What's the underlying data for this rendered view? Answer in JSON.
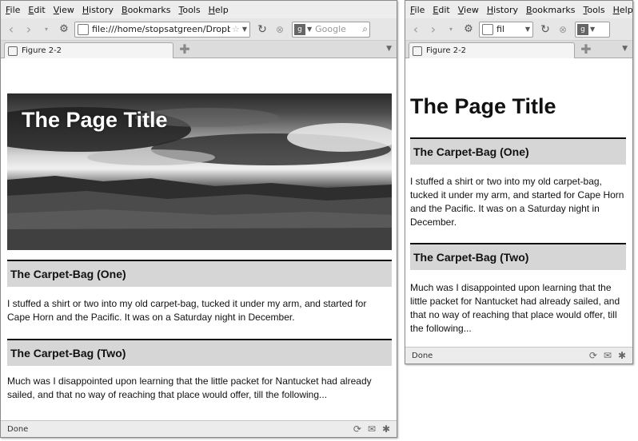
{
  "browser": {
    "menu": [
      "File",
      "Edit",
      "View",
      "History",
      "Bookmarks",
      "Tools",
      "Help"
    ],
    "url_large": "file:///home/stopsatgreen/Dropbox",
    "url_small": "fil",
    "search_placeholder": "Google",
    "search_engine_letter": "g",
    "tab_title": "Figure 2-2",
    "status": "Done"
  },
  "page": {
    "title": "The Page Title",
    "sections": [
      {
        "heading": "The Carpet-Bag (One)",
        "text": "I stuffed a shirt or two into my old carpet-bag, tucked it under my arm, and started for Cape Horn and the Pacific. It was on a Saturday night in December."
      },
      {
        "heading": "The Carpet-Bag (Two)",
        "text": "Much was I disappointed upon learning that the little packet for Nantucket had already sailed, and that no way of reaching that place would offer, till the following..."
      }
    ]
  },
  "icons": {
    "back": "back-arrow-icon",
    "forward": "forward-arrow-icon",
    "history_dropdown": "dropdown-arrow-icon",
    "home": "home-icon",
    "site_identity": "page-icon",
    "bookmark_star": "star-icon",
    "reload": "reload-icon",
    "stop": "stop-icon",
    "search": "magnifier-icon",
    "new_tab": "plus-icon",
    "tab_list": "chevron-down-icon",
    "status_icons": [
      "sync-icon",
      "mail-icon",
      "bug-icon"
    ]
  }
}
